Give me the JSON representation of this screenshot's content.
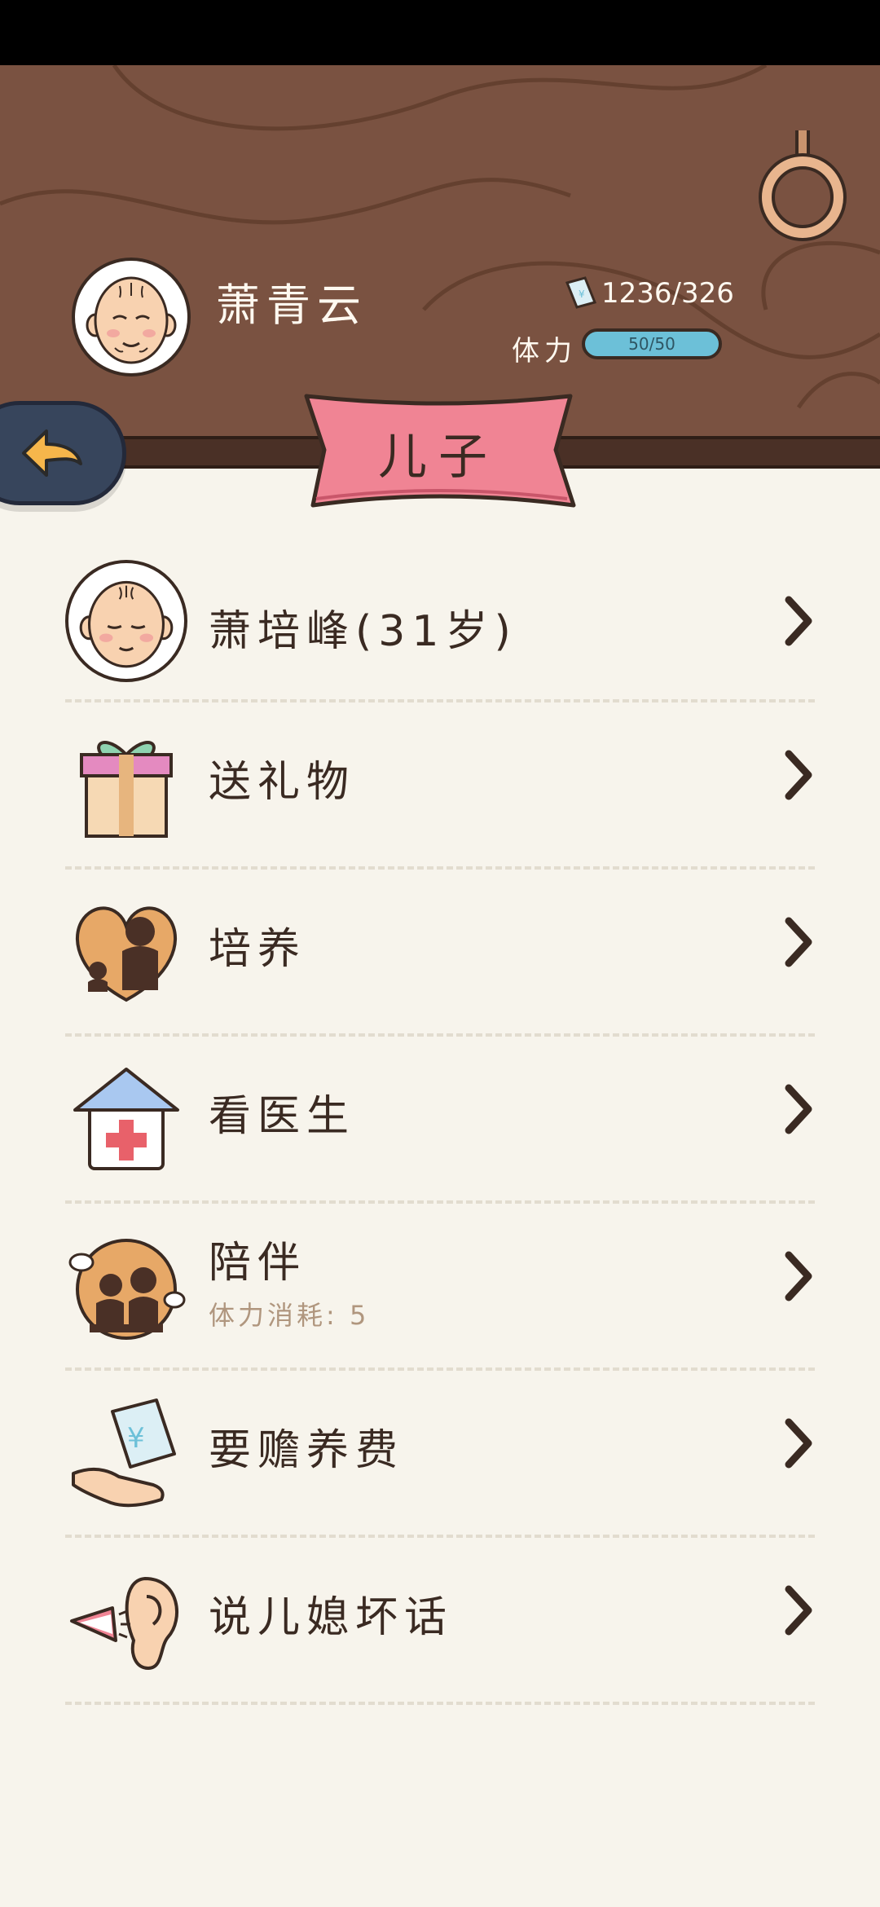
{
  "header": {
    "name": "萧青云",
    "money": "1236/326",
    "stamina_label": "体力",
    "stamina_value": "50/50",
    "stamina_fill": 1.0
  },
  "banner": {
    "title": "儿子"
  },
  "menu": {
    "items": [
      {
        "label": "萧培峰(31岁)",
        "icon": "baby-face-icon"
      },
      {
        "label": "送礼物",
        "icon": "gift-box-icon"
      },
      {
        "label": "培养",
        "icon": "parent-child-heart-icon"
      },
      {
        "label": "看医生",
        "icon": "hospital-house-icon"
      },
      {
        "label": "陪伴",
        "sub": "体力消耗: 5",
        "icon": "family-together-icon"
      },
      {
        "label": "要赡养费",
        "icon": "money-in-hand-icon"
      },
      {
        "label": "说儿媳坏话",
        "icon": "whisper-ear-icon"
      }
    ]
  },
  "colors": {
    "header_wood": "#7A5241",
    "banner_pink": "#F08494",
    "stamina_bar": "#6CC0D8",
    "page_bg": "#F7F4EC",
    "sub_text": "#B0967E"
  }
}
